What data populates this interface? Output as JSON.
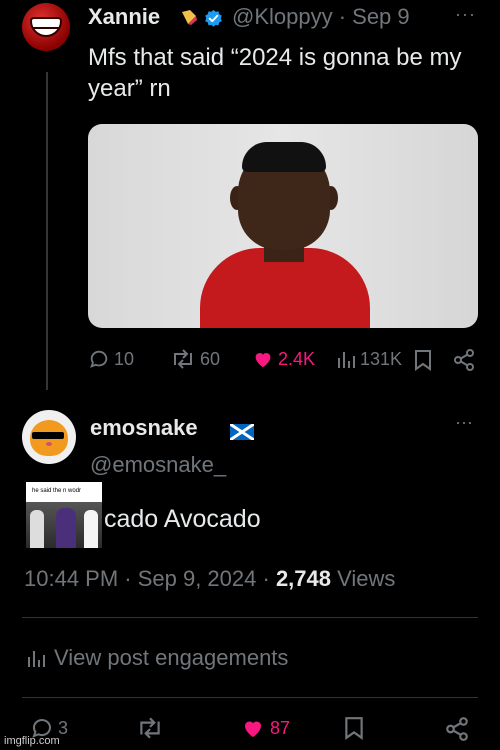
{
  "post1": {
    "display_name": "Xannie",
    "handle_date": "@Kloppyy · Sep 9",
    "more": "···",
    "text": "Mfs that said “2024 is gonna be my year” rn",
    "replies": "10",
    "reposts": "60",
    "likes": "2.4K",
    "views": "131K"
  },
  "post2": {
    "display_name": "emosnake",
    "handle": "@emosnake_",
    "more": "···",
    "meme_caption": "he said the n wodr",
    "text": "cado Avocado",
    "time_date": "10:44 PM · Sep 9, 2024 · ",
    "views_count": "2,748",
    "views_label": " Views",
    "engagements": "View post engagements",
    "replies": "3",
    "likes": "87"
  },
  "watermark": "imgflip.com",
  "colors": {
    "background": "#000000",
    "text": "#e7e9ea",
    "muted": "#71767b",
    "like_pink": "#f91880",
    "verified_blue": "#1d9bf0"
  },
  "icons": [
    "reply-icon",
    "repost-icon",
    "like-icon",
    "views-icon",
    "bookmark-icon",
    "share-icon",
    "verified-icon",
    "scotland-flag-icon"
  ]
}
